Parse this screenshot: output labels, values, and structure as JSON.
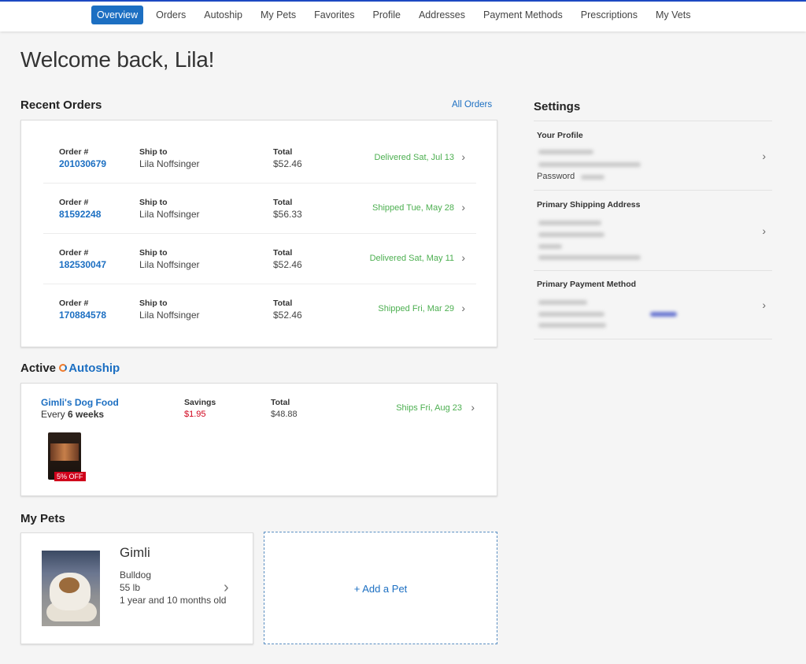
{
  "nav": {
    "tabs": [
      "Overview",
      "Orders",
      "Autoship",
      "My Pets",
      "Favorites",
      "Profile",
      "Addresses",
      "Payment Methods",
      "Prescriptions",
      "My Vets"
    ],
    "active": "Overview"
  },
  "welcome": "Welcome back, Lila!",
  "recent_orders": {
    "title": "Recent Orders",
    "all_link": "All Orders",
    "labels": {
      "order": "Order #",
      "ship_to": "Ship to",
      "total": "Total"
    },
    "orders": [
      {
        "number": "201030679",
        "ship_to": "Lila Noffsinger",
        "total": "$52.46",
        "status": "Delivered Sat, Jul 13"
      },
      {
        "number": "81592248",
        "ship_to": "Lila Noffsinger",
        "total": "$56.33",
        "status": "Shipped Tue, May 28"
      },
      {
        "number": "182530047",
        "ship_to": "Lila Noffsinger",
        "total": "$52.46",
        "status": "Delivered Sat, May 11"
      },
      {
        "number": "170884578",
        "ship_to": "Lila Noffsinger",
        "total": "$52.46",
        "status": "Shipped Fri, Mar 29"
      }
    ]
  },
  "autoship": {
    "title_prefix": "Active",
    "title_brand": "Autoship",
    "item": {
      "name": "Gimli's Dog Food",
      "every_prefix": "Every",
      "frequency": "6 weeks",
      "savings_label": "Savings",
      "savings": "$1.95",
      "total_label": "Total",
      "total": "$48.88",
      "status": "Ships Fri, Aug 23",
      "badge": "5% OFF"
    }
  },
  "pets": {
    "title": "My Pets",
    "items": [
      {
        "name": "Gimli",
        "breed": "Bulldog",
        "weight": "55 lb",
        "age": "1 year and 10 months old"
      }
    ],
    "add_label": "+ Add a Pet"
  },
  "settings": {
    "title": "Settings",
    "sections": [
      {
        "title": "Your Profile",
        "extra": "Password"
      },
      {
        "title": "Primary Shipping Address"
      },
      {
        "title": "Primary Payment Method"
      }
    ]
  },
  "colors": {
    "accent": "#1c6fc2",
    "success": "#4caf50",
    "savings": "#d0021b"
  }
}
